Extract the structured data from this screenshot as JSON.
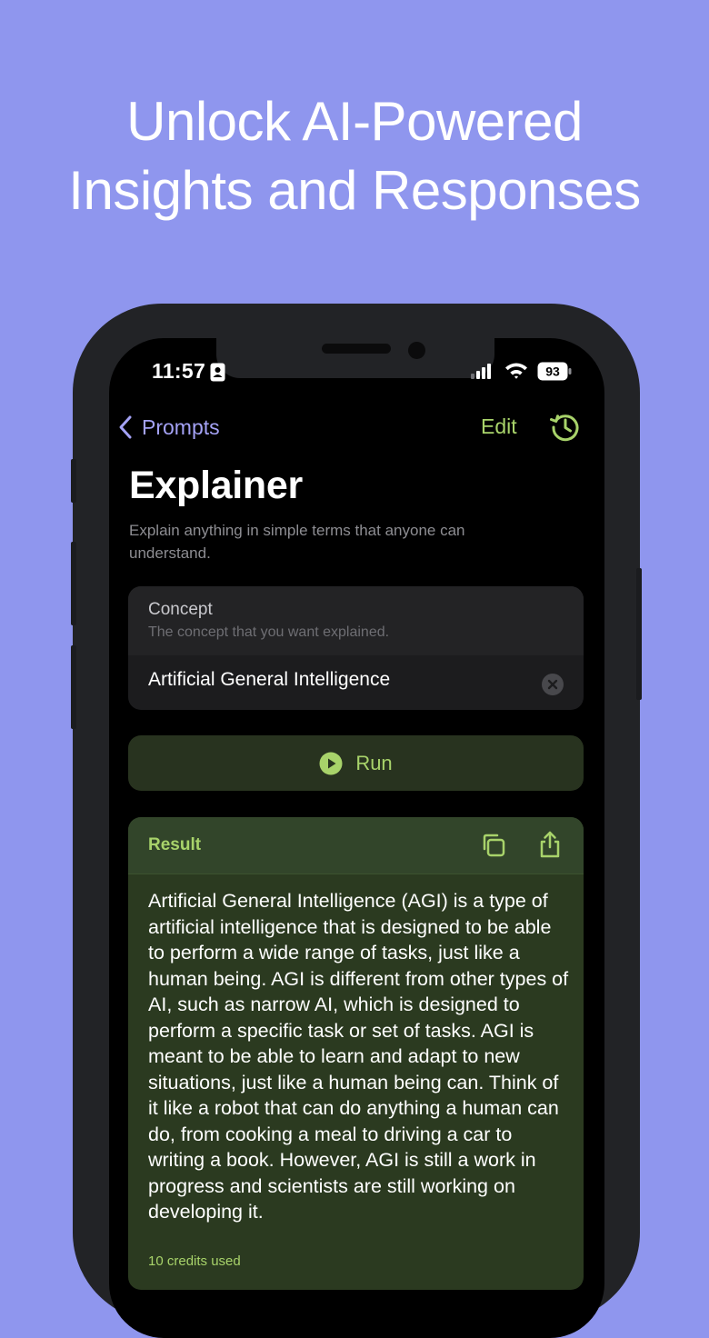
{
  "headline": {
    "line1": "Unlock AI-Powered",
    "line2": "Insights and Responses"
  },
  "status_bar": {
    "time": "11:57",
    "battery": "93"
  },
  "nav": {
    "back_label": "Prompts",
    "edit_label": "Edit"
  },
  "page": {
    "title": "Explainer",
    "description": "Explain anything in simple terms that anyone can understand."
  },
  "concept": {
    "label": "Concept",
    "hint": "The concept that you want explained.",
    "value": "Artificial General Intelligence"
  },
  "run_button": {
    "label": "Run"
  },
  "result": {
    "label": "Result",
    "text": "Artificial General Intelligence (AGI) is a type of artificial intelligence that is designed to be able to perform a wide range of tasks, just like a human being. AGI is different from other types of AI, such as narrow AI, which is designed to perform a specific task or set of tasks. AGI is meant to be able to learn and adapt to new situations, just like a human being can. Think of it like a robot that can do anything a human can do, from cooking a meal to driving a car to writing a book. However, AGI is still a work in progress and scientists are still working on developing it.",
    "footer": "10 credits used"
  },
  "colors": {
    "background": "#8f96ee",
    "accent_green": "#a8d36a",
    "accent_purple": "#a4a2f5"
  }
}
